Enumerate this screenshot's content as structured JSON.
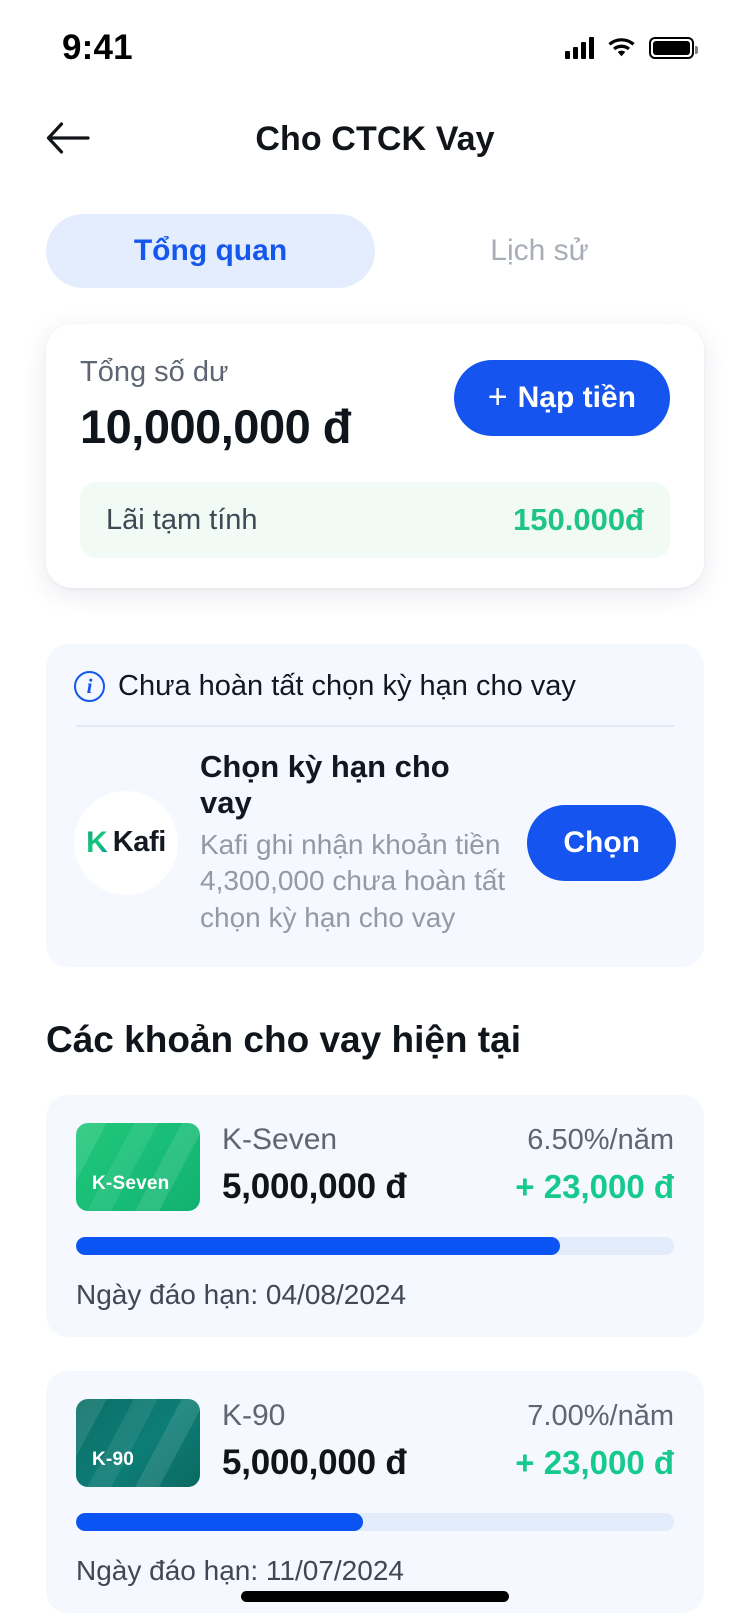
{
  "status_bar": {
    "time": "9:41",
    "cellular_icon": "signal-bars-icon",
    "wifi_icon": "wifi-icon",
    "battery_icon": "battery-full-icon"
  },
  "header": {
    "back_icon": "back-arrow-icon",
    "title": "Cho CTCK Vay"
  },
  "tabs": {
    "items": [
      {
        "label": "Tổng quan",
        "active": true
      },
      {
        "label": "Lịch sử",
        "active": false
      }
    ]
  },
  "balance": {
    "label": "Tổng số dư",
    "amount": "10,000,000 đ",
    "deposit_button": {
      "plus": "+",
      "label": "Nạp tiền"
    },
    "interest_label": "Lãi tạm tính",
    "interest_value": "150.000đ"
  },
  "notice": {
    "info_icon": "info-circle-icon",
    "headline": "Chưa hoàn tất chọn kỳ hạn cho vay",
    "brand": {
      "mark": "K",
      "name": "Kafi"
    },
    "title": "Chọn kỳ hạn cho vay",
    "description": "Kafi ghi nhận khoản tiền 4,300,000 chưa hoàn tất chọn kỳ hạn cho vay",
    "action_label": "Chọn"
  },
  "loans_section": {
    "title": "Các khoản cho vay hiện tại",
    "items": [
      {
        "thumb_label": "K-Seven",
        "name": "K-Seven",
        "rate": "6.50%/năm",
        "amount": "5,000,000 đ",
        "profit": "+ 23,000 đ",
        "progress_percent": 81,
        "due_text": "Ngày đáo hạn: 04/08/2024"
      },
      {
        "thumb_label": "K-90",
        "name": "K-90",
        "rate": "7.00%/năm",
        "amount": "5,000,000 đ",
        "profit": "+ 23,000 đ",
        "progress_percent": 48,
        "due_text": "Ngày đáo hạn: 11/07/2024"
      }
    ]
  },
  "colors": {
    "primary_blue": "#1554ef",
    "progress_blue": "#0b54f4",
    "tab_active_bg": "#e3edfe",
    "green": "#16c98c",
    "interest_green": "#1ec489",
    "card_bg": "#f5f8fe",
    "thumb_k_seven_from": "#22c77a",
    "thumb_k_seven_to": "#13b573",
    "thumb_k90_from": "#0b6f68",
    "thumb_k90_to": "#0d8178"
  }
}
